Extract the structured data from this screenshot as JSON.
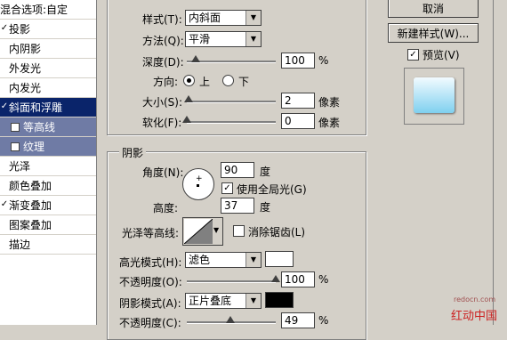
{
  "left_list": {
    "header": "混合选项:自定",
    "items": [
      {
        "label": "投影",
        "checked": true,
        "state": "normal"
      },
      {
        "label": "内阴影",
        "checked": false,
        "state": "normal"
      },
      {
        "label": "外发光",
        "checked": false,
        "state": "normal"
      },
      {
        "label": "内发光",
        "checked": false,
        "state": "normal"
      },
      {
        "label": "斜面和浮雕",
        "checked": true,
        "state": "selected"
      },
      {
        "label": "等高线",
        "checked": false,
        "state": "sub"
      },
      {
        "label": "纹理",
        "checked": false,
        "state": "sub"
      },
      {
        "label": "光泽",
        "checked": false,
        "state": "normal"
      },
      {
        "label": "颜色叠加",
        "checked": false,
        "state": "normal"
      },
      {
        "label": "渐变叠加",
        "checked": true,
        "state": "normal"
      },
      {
        "label": "图案叠加",
        "checked": false,
        "state": "normal"
      },
      {
        "label": "描边",
        "checked": false,
        "state": "normal"
      }
    ]
  },
  "structure": {
    "style_label": "样式(T):",
    "style_value": "内斜面",
    "technique_label": "方法(Q):",
    "technique_value": "平滑",
    "depth_label": "深度(D):",
    "depth_value": "100",
    "depth_unit": "%",
    "depth_fraction": 0.1,
    "direction_label": "方向:",
    "direction_up": "上",
    "direction_down": "下",
    "size_label": "大小(S):",
    "size_value": "2",
    "size_unit": "像素",
    "size_fraction": 0.02,
    "soften_label": "软化(F):",
    "soften_value": "0",
    "soften_unit": "像素",
    "soften_fraction": 0.0
  },
  "shading": {
    "title": "阴影",
    "angle_label": "角度(N):",
    "angle_value": "90",
    "angle_unit": "度",
    "global_light_label": "使用全局光(G)",
    "global_light_checked": true,
    "altitude_label": "高度:",
    "altitude_value": "37",
    "altitude_unit": "度",
    "gloss_contour_label": "光泽等高线:",
    "anti_alias_label": "消除锯齿(L)",
    "anti_alias_checked": false,
    "highlight_mode_label": "高光模式(H):",
    "highlight_mode_value": "滤色",
    "highlight_color": "#ffffff",
    "highlight_opacity_label": "不透明度(O):",
    "highlight_opacity_value": "100",
    "highlight_opacity_unit": "%",
    "highlight_opacity_fraction": 1.0,
    "shadow_mode_label": "阴影模式(A):",
    "shadow_mode_value": "正片叠底",
    "shadow_color": "#000000",
    "shadow_opacity_label": "不透明度(C):",
    "shadow_opacity_value": "49",
    "shadow_opacity_unit": "%",
    "shadow_opacity_fraction": 0.49
  },
  "right_panel": {
    "cancel_label": "取消",
    "new_style_label": "新建样式(W)...",
    "preview_label": "预览(V)",
    "preview_checked": true
  },
  "watermark": {
    "line1": "redocn.com",
    "line2": "红动中国"
  }
}
